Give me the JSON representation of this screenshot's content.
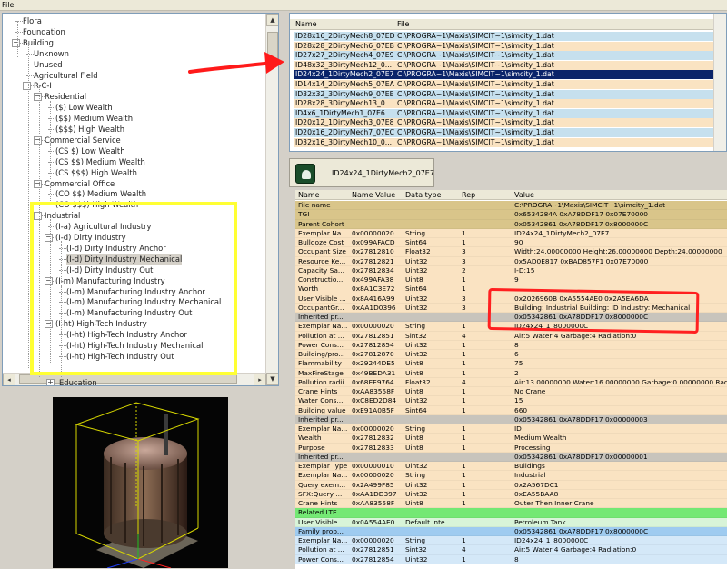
{
  "menubar": {
    "file": "File"
  },
  "tree": {
    "rows": [
      {
        "label": "Flora"
      },
      {
        "label": "Foundation"
      },
      {
        "label": "Building"
      },
      {
        "label": "Unknown"
      },
      {
        "label": "Unused"
      },
      {
        "label": "Agricultural Field"
      },
      {
        "label": "R-C-I"
      },
      {
        "label": "Residential"
      },
      {
        "label": "($) Low Wealth"
      },
      {
        "label": "($$) Medium Wealth"
      },
      {
        "label": "($$$) High Wealth"
      },
      {
        "label": "Commercial Service"
      },
      {
        "label": "(CS $) Low Wealth"
      },
      {
        "label": "(CS $$) Medium Wealth"
      },
      {
        "label": "(CS $$$) High Wealth"
      },
      {
        "label": "Commercial Office"
      },
      {
        "label": "(CO $$) Medium Wealth"
      },
      {
        "label": "(CO $$$) High Wealth"
      },
      {
        "label": "Industrial"
      },
      {
        "label": "(I-a) Agricultural Industry"
      },
      {
        "label": "(I-d) Dirty Industry"
      },
      {
        "label": "(I-d) Dirty Industry Anchor"
      },
      {
        "label": "(I-d) Dirty Industry Mechanical"
      },
      {
        "label": "(I-d) Dirty Industry Out"
      },
      {
        "label": "(I-m) Manufacturing Industry"
      },
      {
        "label": "(I-m) Manufacturing Industry Anchor"
      },
      {
        "label": "(I-m) Manufacturing Industry Mechanical"
      },
      {
        "label": "(I-m) Manufacturing Industry Out"
      },
      {
        "label": "(I-ht) High-Tech Industry"
      },
      {
        "label": "(I-ht) High-Tech Industry Anchor"
      },
      {
        "label": "(I-ht) High-Tech Industry Mechanical"
      },
      {
        "label": "(I-ht) High-Tech Industry Out"
      },
      {
        "label": "Education"
      }
    ]
  },
  "filelist": {
    "col_name": "Name",
    "col_file": "File",
    "rows": [
      {
        "name": "ID28x16_2DirtyMech8_07ED",
        "file": "C:\\PROGRA~1\\Maxis\\SIMCIT~1\\simcity_1.dat",
        "color": "#c6e0ee"
      },
      {
        "name": "ID28x28_2DirtyMech6_07EB",
        "file": "C:\\PROGRA~1\\Maxis\\SIMCIT~1\\simcity_1.dat",
        "color": "#fae3c2"
      },
      {
        "name": "ID27x27_2DirtyMech4_07E9",
        "file": "C:\\PROGRA~1\\Maxis\\SIMCIT~1\\simcity_1.dat",
        "color": "#c6e0ee"
      },
      {
        "name": "ID48x32_3DirtyMech12_0...",
        "file": "C:\\PROGRA~1\\Maxis\\SIMCIT~1\\simcity_1.dat",
        "color": "#fae3c2"
      },
      {
        "name": "ID24x24_1DirtyMech2_07E7",
        "file": "C:\\PROGRA~1\\Maxis\\SIMCIT~1\\simcity_1.dat",
        "color": "#0a246a"
      },
      {
        "name": "ID14x14_2DirtyMech5_07EA",
        "file": "C:\\PROGRA~1\\Maxis\\SIMCIT~1\\simcity_1.dat",
        "color": "#fae3c2"
      },
      {
        "name": "ID32x32_3DirtyMech9_07EE",
        "file": "C:\\PROGRA~1\\Maxis\\SIMCIT~1\\simcity_1.dat",
        "color": "#c6e0ee"
      },
      {
        "name": "ID28x28_3DirtyMech13_0...",
        "file": "C:\\PROGRA~1\\Maxis\\SIMCIT~1\\simcity_1.dat",
        "color": "#fae3c2"
      },
      {
        "name": "ID4x6_1DirtyMech1_07E6",
        "file": "C:\\PROGRA~1\\Maxis\\SIMCIT~1\\simcity_1.dat",
        "color": "#c6e0ee"
      },
      {
        "name": "ID20x12_1DirtyMech3_07E8",
        "file": "C:\\PROGRA~1\\Maxis\\SIMCIT~1\\simcity_1.dat",
        "color": "#fae3c2"
      },
      {
        "name": "ID20x16_2DirtyMech7_07EC",
        "file": "C:\\PROGRA~1\\Maxis\\SIMCIT~1\\simcity_1.dat",
        "color": "#c6e0ee"
      },
      {
        "name": "ID32x16_3DirtyMech10_0...",
        "file": "C:\\PROGRA~1\\Maxis\\SIMCIT~1\\simcity_1.dat",
        "color": "#fae3c2"
      }
    ]
  },
  "tab": {
    "label": "ID24x24_1DirtyMech2_07E7"
  },
  "grid": {
    "headers": {
      "name": "Name",
      "name_value": "Name Value",
      "data_type": "Data type",
      "rep": "Rep",
      "value": "Value"
    },
    "rows": [
      {
        "name": "File name",
        "nv": "",
        "type": "",
        "rep": "",
        "value": "C:\\PROGRA~1\\Maxis\\SIMCIT~1\\simcity_1.dat",
        "color": "#d9c58a"
      },
      {
        "name": "TGI",
        "nv": "",
        "type": "",
        "rep": "",
        "value": "0x6534284A 0xA78DDF17 0x07E70000",
        "color": "#d9c58a"
      },
      {
        "name": "Parent Cohort",
        "nv": "",
        "type": "",
        "rep": "",
        "value": "0x05342861 0xA78DDF17 0x8000000C",
        "color": "#d9c58a"
      },
      {
        "name": "Exemplar Na...",
        "nv": "0x00000020",
        "type": "String",
        "rep": "1",
        "value": "ID24x24_1DirtyMech2_07E7",
        "color": "#fae3c2"
      },
      {
        "name": "Bulldoze Cost",
        "nv": "0x099AFACD",
        "type": "Sint64",
        "rep": "1",
        "value": "90",
        "color": "#fae3c2"
      },
      {
        "name": "Occupant Size",
        "nv": "0x27812810",
        "type": "Float32",
        "rep": "3",
        "value": "Width:24.00000000 Height:26.00000000 Depth:24.00000000",
        "color": "#fae3c2"
      },
      {
        "name": "Resource Ke...",
        "nv": "0x27812821",
        "type": "Uint32",
        "rep": "3",
        "value": "0x5AD0E817 0xBAD857F1 0x07E70000",
        "color": "#fae3c2"
      },
      {
        "name": "Capacity Sa...",
        "nv": "0x27812834",
        "type": "Uint32",
        "rep": "2",
        "value": "I-D:15",
        "color": "#fae3c2"
      },
      {
        "name": "Constructio...",
        "nv": "0x499AFA38",
        "type": "Uint8",
        "rep": "1",
        "value": "9",
        "color": "#fae3c2"
      },
      {
        "name": "Worth",
        "nv": "0x8A1C3E72",
        "type": "Sint64",
        "rep": "1",
        "value": "",
        "color": "#fae3c2"
      },
      {
        "name": "User Visible ...",
        "nv": "0x8A416A99",
        "type": "Uint32",
        "rep": "3",
        "value": "0x2026960B 0xA5554AE0 0x2A5EA6DA",
        "color": "#fae3c2"
      },
      {
        "name": "OccupantGr...",
        "nv": "0xAA1D0396",
        "type": "Uint32",
        "rep": "3",
        "value": "Building: Industrial Building: ID Industry: Mechanical",
        "color": "#fae3c2"
      },
      {
        "name": "Inherited pr...",
        "nv": "",
        "type": "",
        "rep": "",
        "value": "0x05342861 0xA78DDF17 0x8000000C",
        "color": "#c8c4bc"
      },
      {
        "name": "Exemplar Na...",
        "nv": "0x00000020",
        "type": "String",
        "rep": "1",
        "value": "ID24x24_1_8000000C",
        "color": "#fae3c2"
      },
      {
        "name": "Pollution at ...",
        "nv": "0x27812851",
        "type": "Sint32",
        "rep": "4",
        "value": "Air:5 Water:4 Garbage:4 Radiation:0",
        "color": "#fae3c2"
      },
      {
        "name": "Power Cons...",
        "nv": "0x27812854",
        "type": "Uint32",
        "rep": "1",
        "value": "8",
        "color": "#fae3c2"
      },
      {
        "name": "Building/pro...",
        "nv": "0x27812870",
        "type": "Uint32",
        "rep": "1",
        "value": "6",
        "color": "#fae3c2"
      },
      {
        "name": "Flammability",
        "nv": "0x29244DE5",
        "type": "Uint8",
        "rep": "1",
        "value": "75",
        "color": "#fae3c2"
      },
      {
        "name": "MaxFireStage",
        "nv": "0x49BEDA31",
        "type": "Uint8",
        "rep": "1",
        "value": "2",
        "color": "#fae3c2"
      },
      {
        "name": "Pollution radii",
        "nv": "0x68EE9764",
        "type": "Float32",
        "rep": "4",
        "value": "Air:13.00000000 Water:16.00000000 Garbage:0.00000000 Radi",
        "color": "#fae3c2"
      },
      {
        "name": "Crane Hints",
        "nv": "0xAA83558F",
        "type": "Uint8",
        "rep": "1",
        "value": "No Crane",
        "color": "#fae3c2"
      },
      {
        "name": "Water Cons...",
        "nv": "0xC8ED2D84",
        "type": "Uint32",
        "rep": "1",
        "value": "15",
        "color": "#fae3c2"
      },
      {
        "name": "Building value",
        "nv": "0xE91A0B5F",
        "type": "Sint64",
        "rep": "1",
        "value": "660",
        "color": "#fae3c2"
      },
      {
        "name": "Inherited pr...",
        "nv": "",
        "type": "",
        "rep": "",
        "value": "0x05342861 0xA78DDF17 0x00000003",
        "color": "#c8c4bc"
      },
      {
        "name": "Exemplar Na...",
        "nv": "0x00000020",
        "type": "String",
        "rep": "1",
        "value": "ID",
        "color": "#fae3c2"
      },
      {
        "name": "Wealth",
        "nv": "0x27812832",
        "type": "Uint8",
        "rep": "1",
        "value": "Medium Wealth",
        "color": "#fae3c2"
      },
      {
        "name": "Purpose",
        "nv": "0x27812833",
        "type": "Uint8",
        "rep": "1",
        "value": "Processing",
        "color": "#fae3c2"
      },
      {
        "name": "Inherited pr...",
        "nv": "",
        "type": "",
        "rep": "",
        "value": "0x05342861 0xA78DDF17 0x00000001",
        "color": "#c8c4bc"
      },
      {
        "name": "Exemplar Type",
        "nv": "0x00000010",
        "type": "Uint32",
        "rep": "1",
        "value": "Buildings",
        "color": "#fae3c2"
      },
      {
        "name": "Exemplar Na...",
        "nv": "0x00000020",
        "type": "String",
        "rep": "1",
        "value": "Industrial",
        "color": "#fae3c2"
      },
      {
        "name": "Query exem...",
        "nv": "0x2A499F85",
        "type": "Uint32",
        "rep": "1",
        "value": "0x2A567DC1",
        "color": "#fae3c2"
      },
      {
        "name": "SFX:Query ...",
        "nv": "0xAA1DD397",
        "type": "Uint32",
        "rep": "1",
        "value": "0xEA55BAA8",
        "color": "#fae3c2"
      },
      {
        "name": "Crane Hints",
        "nv": "0xAA83558F",
        "type": "Uint8",
        "rep": "1",
        "value": "Outer Then Inner Crane",
        "color": "#fae3c2"
      },
      {
        "name": "Related LTE...",
        "nv": "",
        "type": "",
        "rep": "",
        "value": "",
        "color": "#74e874"
      },
      {
        "name": "User Visible ...",
        "nv": "0x0A554AE0",
        "type": "Default inte...",
        "rep": "",
        "value": "Petroleum Tank",
        "color": "#d8f4d8"
      },
      {
        "name": "Family prop...",
        "nv": "",
        "type": "",
        "rep": "",
        "value": "0x05342861 0xA78DDF17 0x8000000C",
        "color": "#9ecbf0"
      },
      {
        "name": "Exemplar Na...",
        "nv": "0x00000020",
        "type": "String",
        "rep": "1",
        "value": "ID24x24_1_8000000C",
        "color": "#d4e8f8"
      },
      {
        "name": "Pollution at ...",
        "nv": "0x27812851",
        "type": "Sint32",
        "rep": "4",
        "value": "Air:5 Water:4 Garbage:4 Radiation:0",
        "color": "#d4e8f8"
      },
      {
        "name": "Power Cons...",
        "nv": "0x27812854",
        "type": "Uint32",
        "rep": "1",
        "value": "8",
        "color": "#d4e8f8"
      }
    ]
  }
}
